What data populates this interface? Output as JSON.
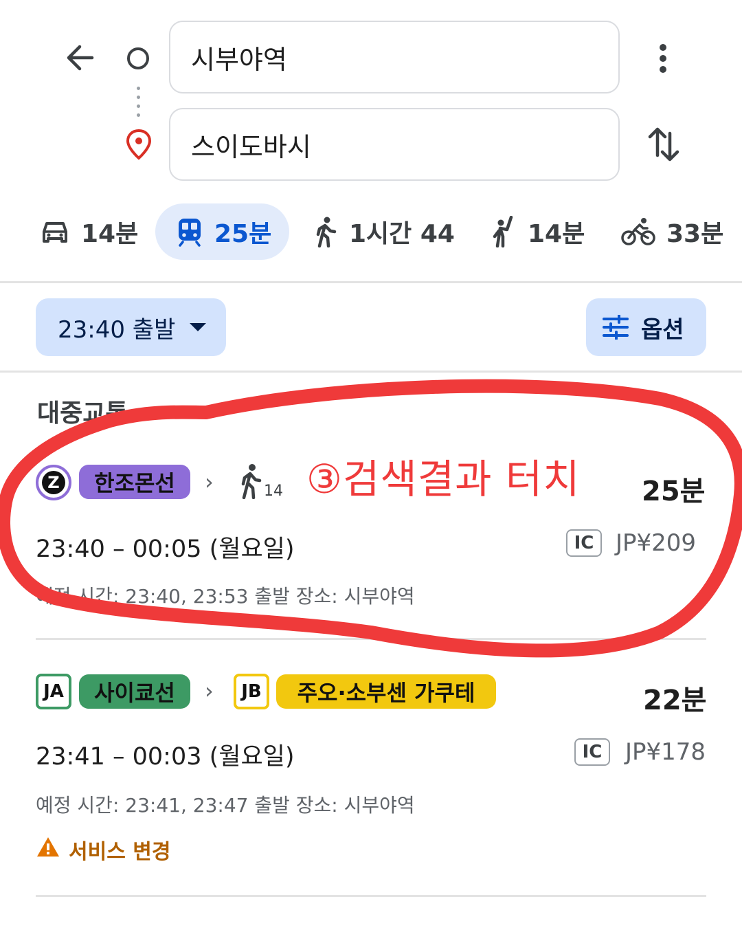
{
  "header": {
    "origin": "시부야역",
    "destination": "스이도바시",
    "back_icon": "arrow-left-icon",
    "more_icon": "more-vert-icon",
    "swap_icon": "swap-vert-icon"
  },
  "modes": [
    {
      "icon": "car-icon",
      "label": "14분"
    },
    {
      "icon": "transit-icon",
      "label": "25분",
      "selected": true
    },
    {
      "icon": "walk-icon",
      "label": "1시간 44"
    },
    {
      "icon": "ride-hail-icon",
      "label": "14분"
    },
    {
      "icon": "bike-icon",
      "label": "33분"
    }
  ],
  "depart": {
    "label": "23:40 출발"
  },
  "options": {
    "label": "옵션"
  },
  "section_title": "대중교통",
  "annotation": "③검색결과  터치",
  "routes": [
    {
      "line_letter": "Z",
      "line_name": "한조몬선",
      "line_color": "#8e6dd8",
      "walk_minutes": "14",
      "duration": "25분",
      "times": "23:40 – 00:05 (월요일)",
      "fare_badge": "IC",
      "fare": "JP¥209",
      "note": "예정 시간: 23:40, 23:53 출발 장소: 시부야역"
    },
    {
      "badge1": "JA",
      "badge1_color": "#3d9a64",
      "line1_name": "사이쿄선",
      "line1_color": "#3d9a64",
      "badge2": "JB",
      "badge2_color": "#f2c80f",
      "line2_name": "주오·소부센 가쿠테",
      "line2_color": "#f2c80f",
      "duration": "22분",
      "times": "23:41 – 00:03 (월요일)",
      "fare_badge": "IC",
      "fare": "JP¥178",
      "note": "예정 시간: 23:41, 23:47 출발 장소: 시부야역",
      "warning": "서비스 변경"
    }
  ],
  "colors": {
    "accent_blue": "#0b57d0",
    "pill_blue": "#d3e3fd",
    "annotation_red": "#ef3a3a",
    "warning": "#b06000"
  }
}
